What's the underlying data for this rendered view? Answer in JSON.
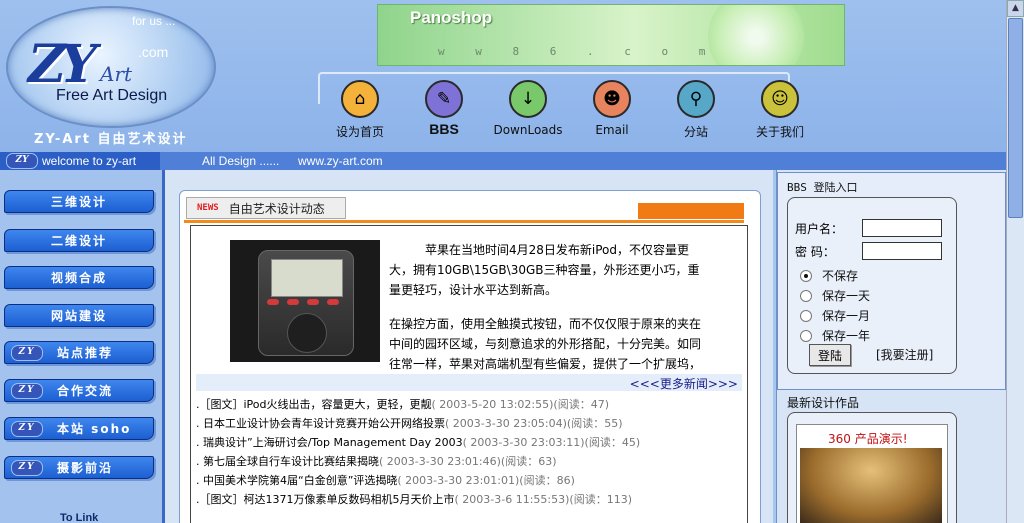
{
  "header": {
    "logo": {
      "zy": "ZY",
      "art": "Art",
      "com": ".com",
      "for_us": "for us ...",
      "free_art_design": "Free Art Design",
      "cn_title": "ZY-Art 自由艺术设计"
    },
    "banner": {
      "title": "Panoshop",
      "url_letters": "w w 8 6 . c o m"
    },
    "nav": [
      {
        "label": "设为首页",
        "icon": "home-icon"
      },
      {
        "label": "BBS",
        "icon": "pencil-icon"
      },
      {
        "label": "DownLoads",
        "icon": "download-arrow-icon"
      },
      {
        "label": "Email",
        "icon": "mask-icon"
      },
      {
        "label": "分站",
        "icon": "magnifier-icon"
      },
      {
        "label": "关于我们",
        "icon": "smiley-icon"
      }
    ]
  },
  "strip": {
    "welcome": "welcome to zy-art",
    "all_design": "All Design ......",
    "url": "www.zy-art.com"
  },
  "sidebar": {
    "items": [
      {
        "label": "三维设计"
      },
      {
        "label": "二维设计"
      },
      {
        "label": "视频合成"
      },
      {
        "label": "网站建设"
      },
      {
        "label": "站点推荐"
      },
      {
        "label": "合作交流"
      },
      {
        "label": "本站 soho"
      },
      {
        "label": "摄影前沿"
      }
    ],
    "to_link": "To Link"
  },
  "main": {
    "news_tag": "NEWS",
    "news_title": "自由艺术设计动态",
    "article": {
      "p1": "苹果在当地时间4月28日发布新iPod，不仅容量更大，拥有10GB\\15GB\\30GB三种容量，外形还更小巧，重量更轻巧，设计水平达到新高。",
      "p2": "在操控方面，使用全触摸式按钮，而不仅仅限于原来的夹在中间的园环区域，与刻意追求的外形搭配，十分完美。如同往常一样，苹果对高端机型有些偏爱，提供了一个扩展坞，"
    },
    "more_news": "<<<更多新闻>>>",
    "news_list": [
      {
        "title": ".［图文］iPod火线出击，容量更大，更轻，更靓",
        "meta": "( 2003-5-20 13:02:55)(阅读：47)"
      },
      {
        "title": ". 日本工业设计协会青年设计竞赛开始公开网络投票",
        "meta": "( 2003-3-30 23:05:04)(阅读：55)"
      },
      {
        "title": ". 瑞典设计”上海研讨会/Top Management Day 2003",
        "meta": "( 2003-3-30 23:03:11)(阅读：45)"
      },
      {
        "title": ". 第七届全球自行车设计比赛结果揭晓",
        "meta": "( 2003-3-30 23:01:46)(阅读：63)"
      },
      {
        "title": ". 中国美术学院第4届“白金创意”评选揭晓",
        "meta": "( 2003-3-30 23:01:01)(阅读：86)"
      },
      {
        "title": ".［图文］柯达1371万像素单反数码相机5月天价上市",
        "meta": "( 2003-3-6 11:55:53)(阅读：113)"
      }
    ]
  },
  "right": {
    "bbs_title": "BBS 登陆入口",
    "username_label": "用户名：",
    "password_label": "密  码：",
    "username_value": "",
    "password_value": "",
    "options": [
      "不保存",
      "保存一天",
      "保存一月",
      "保存一年"
    ],
    "login_button": "登陆",
    "register_link": "[我要注册]",
    "works_title": "最新设计作品",
    "promo": "360 产品演示!"
  }
}
